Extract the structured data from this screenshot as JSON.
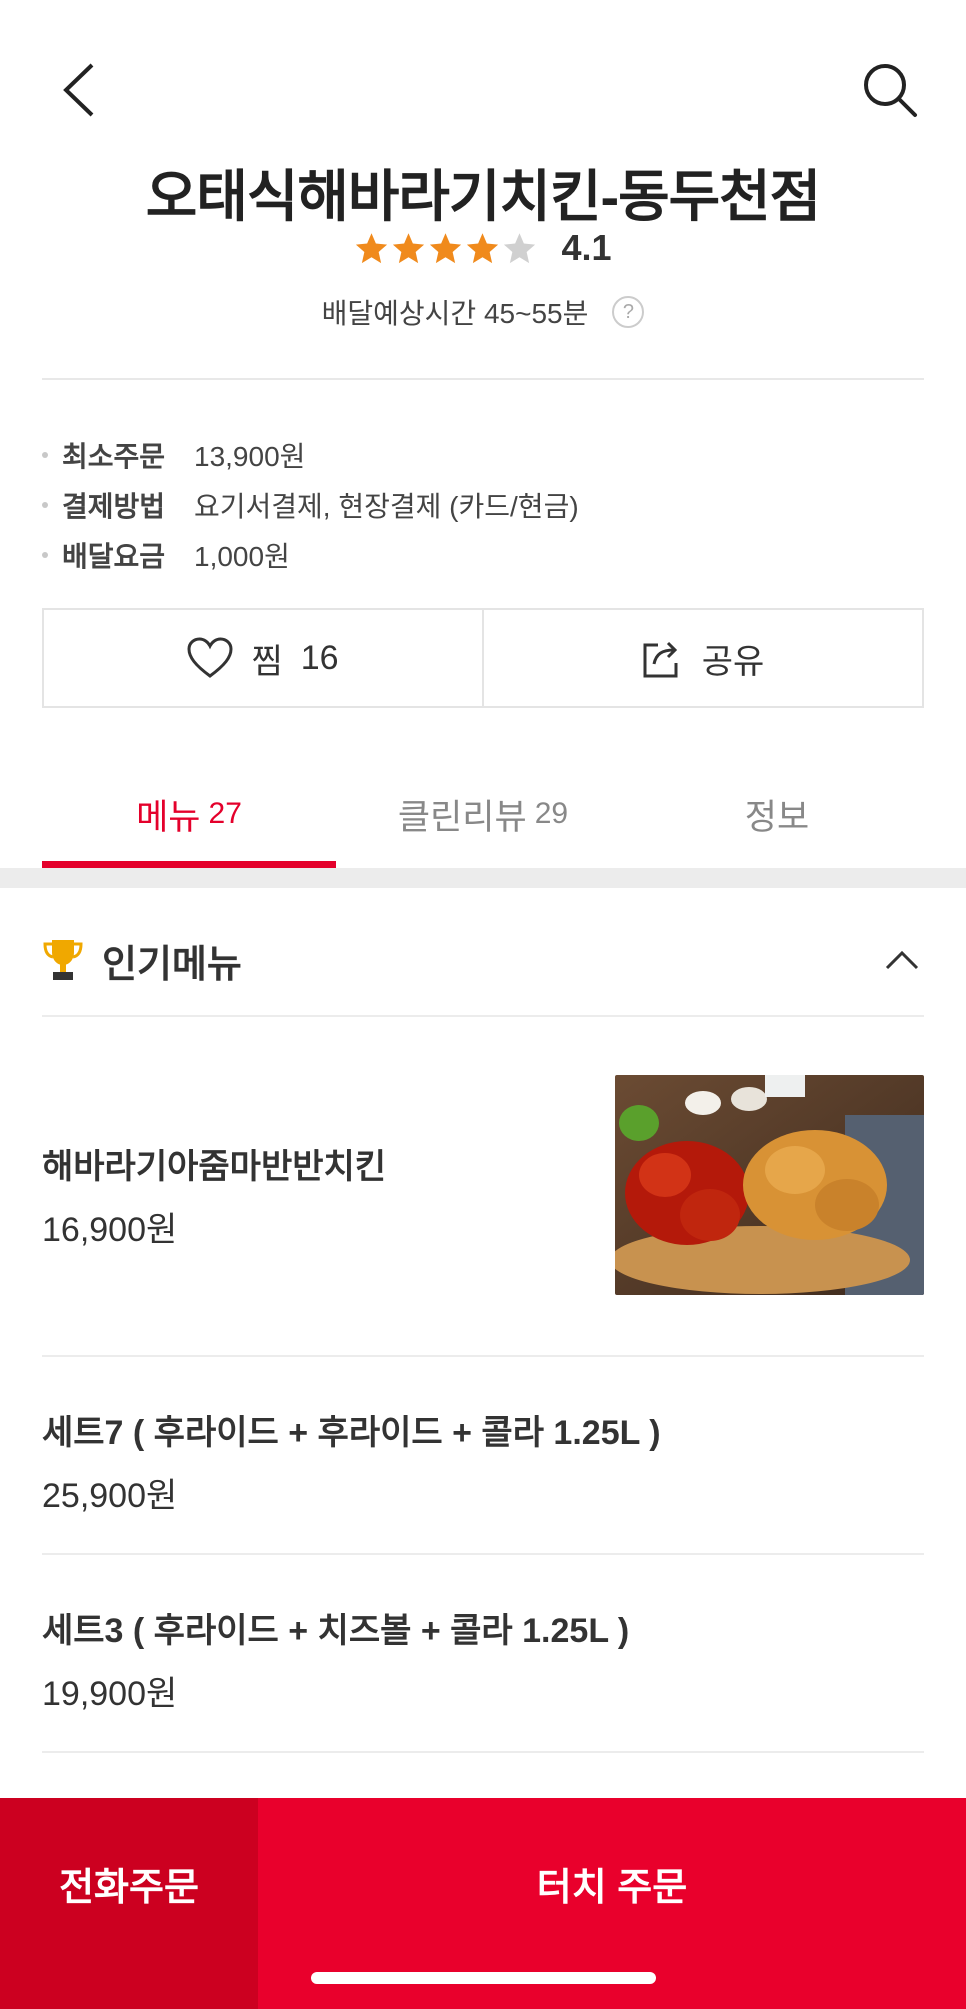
{
  "store": {
    "name": "오태식해바라기치킨-동두천점",
    "rating": "4.1",
    "rating_stars": 4,
    "eta_label": "배달예상시간 45~55분",
    "help_glyph": "?"
  },
  "info": [
    {
      "label": "최소주문",
      "value": "13,900원"
    },
    {
      "label": "결제방법",
      "value": "요기서결제, 현장결제 (카드/현금)"
    },
    {
      "label": "배달요금",
      "value": "1,000원"
    }
  ],
  "actions": {
    "like_label": "찜",
    "like_count": "16",
    "share_label": "공유"
  },
  "tabs": [
    {
      "label": "메뉴",
      "count": "27"
    },
    {
      "label": "클린리뷰",
      "count": "29"
    },
    {
      "label": "정보",
      "count": ""
    }
  ],
  "section": {
    "title": "인기메뉴"
  },
  "menu_items": [
    {
      "name": "해바라기아줌마반반치킨",
      "price": "16,900원"
    },
    {
      "name": "세트7 ( 후라이드 + 후라이드 + 콜라 1.25L )",
      "price": "25,900원"
    },
    {
      "name": "세트3 ( 후라이드 + 치즈볼 + 콜라 1.25L )",
      "price": "19,900원"
    }
  ],
  "bottom": {
    "phone_order": "전화주문",
    "touch_order": "터치 주문"
  },
  "colors": {
    "accent": "#e4002b",
    "star": "#f08a1c",
    "star_empty": "#d0d0d0"
  }
}
